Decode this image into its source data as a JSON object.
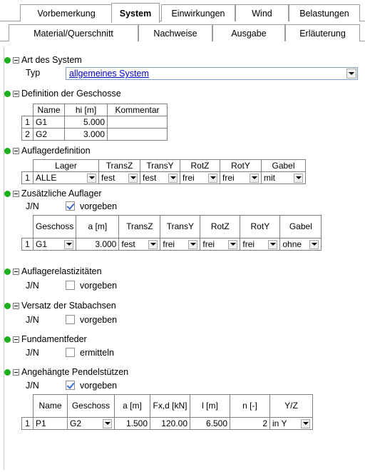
{
  "tabs_row1": [
    "Vorbemerkung",
    "System",
    "Einwirkungen",
    "Wind",
    "Belastungen"
  ],
  "tabs_row2": [
    "Material/Querschnitt",
    "Nachweise",
    "Ausgabe",
    "Erläuterung"
  ],
  "active_tab": "System",
  "art": {
    "title": "Art des System",
    "typ_label": "Typ",
    "typ_value": "allgemeines System"
  },
  "geschosse": {
    "title": "Definition der Geschosse",
    "headers": [
      "Name",
      "hi [m]",
      "Kommentar"
    ],
    "rows": [
      {
        "nr": "1",
        "name": "G1",
        "h": "5.000",
        "kommentar": ""
      },
      {
        "nr": "2",
        "name": "G2",
        "h": "3.000",
        "kommentar": ""
      }
    ]
  },
  "auflager": {
    "title": "Auflagerdefinition",
    "headers": [
      "Lager",
      "TransZ",
      "TransY",
      "RotZ",
      "RotY",
      "Gabel"
    ],
    "rows": [
      {
        "nr": "1",
        "lager": "ALLE",
        "transz": "fest",
        "transy": "fest",
        "rotz": "frei",
        "roty": "frei",
        "gabel": "mit"
      }
    ]
  },
  "zus_auflager": {
    "title": "Zusätzliche Auflager",
    "jn_label": "J/N",
    "check_label": "vorgeben",
    "checked": true,
    "headers": [
      "Geschoss",
      "a [m]",
      "TransZ",
      "TransY",
      "RotZ",
      "RotY",
      "Gabel"
    ],
    "rows": [
      {
        "nr": "1",
        "geschoss": "G1",
        "a": "3.000",
        "transz": "fest",
        "transy": "frei",
        "rotz": "frei",
        "roty": "frei",
        "gabel": "ohne"
      }
    ]
  },
  "elast": {
    "title": "Auflagerelastizitäten",
    "jn_label": "J/N",
    "check_label": "vorgeben",
    "checked": false
  },
  "versatz": {
    "title": "Versatz der Stabachsen",
    "jn_label": "J/N",
    "check_label": "vorgeben",
    "checked": false
  },
  "fundament": {
    "title": "Fundamentfeder",
    "jn_label": "J/N",
    "check_label": "ermitteln",
    "checked": false
  },
  "pendel": {
    "title": "Angehängte Pendelstützen",
    "jn_label": "J/N",
    "check_label": "vorgeben",
    "checked": true,
    "headers": [
      "Name",
      "Geschoss",
      "a [m]",
      "Fx,d [kN]",
      "l [m]",
      "n [-]",
      "Y/Z"
    ],
    "rows": [
      {
        "nr": "1",
        "name": "P1",
        "geschoss": "G2",
        "a": "1.500",
        "fxd": "120.00",
        "l": "6.500",
        "n": "2",
        "yz": "in Y"
      }
    ]
  }
}
